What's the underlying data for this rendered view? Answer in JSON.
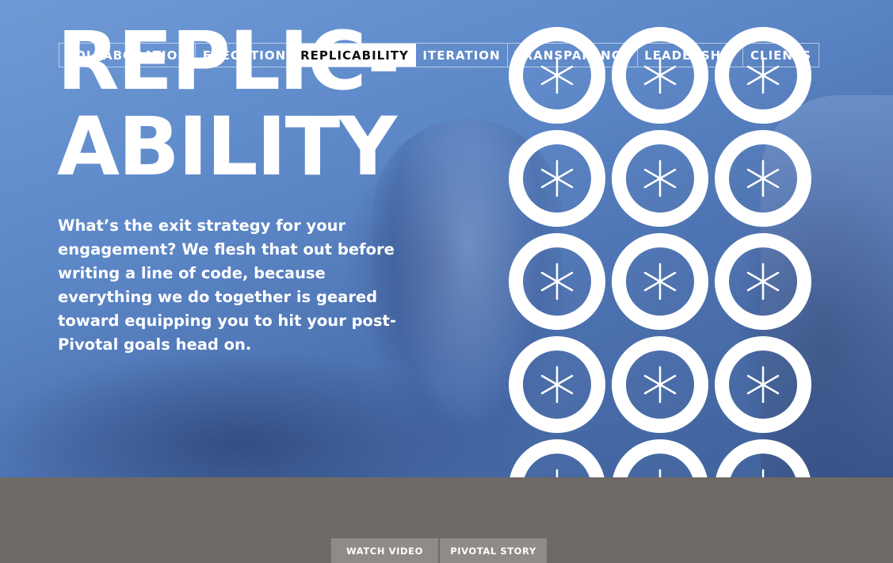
{
  "hero": {
    "title_line1": "REPLIC-",
    "title_line2": "ABILITY",
    "copy": "What’s the exit strategy for your engagement? We flesh that out before writing a line of code, because everything we do together is geared toward equipping you to hit your post-Pivotal goals head on."
  },
  "nav": {
    "items": [
      {
        "label": "COLLABORATION"
      },
      {
        "label": "EXECUTION"
      },
      {
        "label": "REPLICABILITY",
        "active": true
      },
      {
        "label": "ITERATION"
      },
      {
        "label": "TRANSPARENCY"
      },
      {
        "label": "LEADERSHIP"
      },
      {
        "label": "CLIENTS"
      }
    ]
  },
  "rings": {
    "icon": "asterisk-icon",
    "rows": 5,
    "cols": 3,
    "color": "#ffffff"
  },
  "footer": {
    "watch_video": "WATCH VIDEO",
    "pivotal_story": "PIVOTAL STORY"
  },
  "colors": {
    "hero_tint": "#5d88c8",
    "page_bg": "#6f6a65",
    "button_bg": "#8f8b87",
    "active_tab_bg": "#ffffff"
  }
}
